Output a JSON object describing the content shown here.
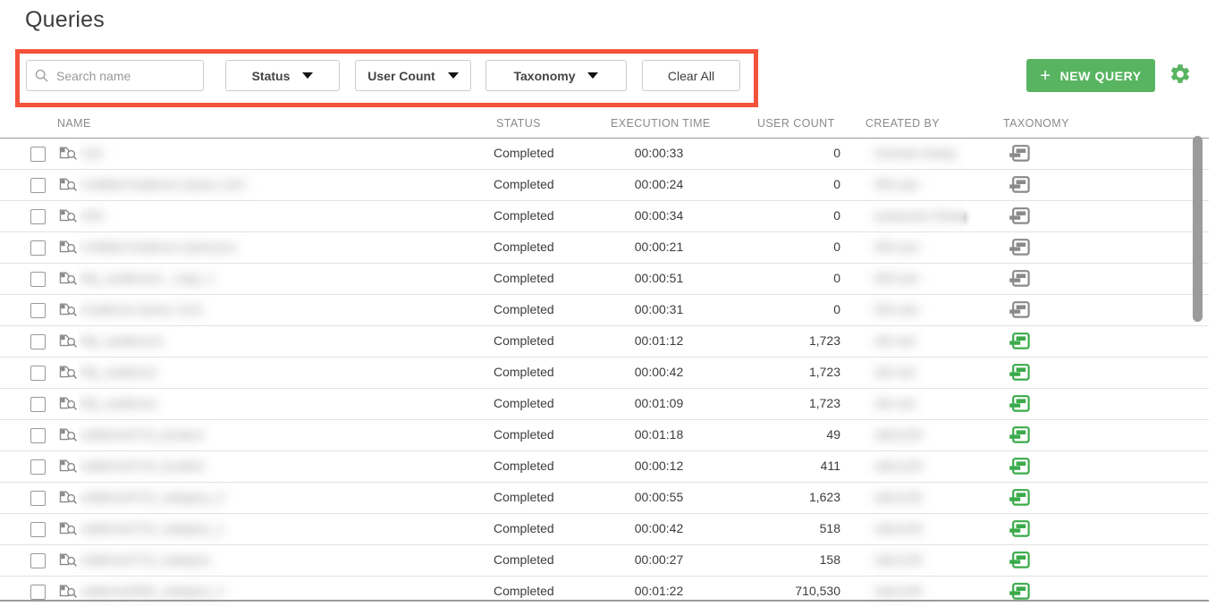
{
  "header": {
    "title": "Queries"
  },
  "toolbar": {
    "search": {
      "placeholder": "Search name",
      "value": "",
      "icon": "search-icon"
    },
    "filters": [
      {
        "id": "status",
        "label": "Status",
        "icon": "chevron-down-icon"
      },
      {
        "id": "usercount",
        "label": "User Count",
        "icon": "chevron-down-icon"
      },
      {
        "id": "taxonomy",
        "label": "Taxonomy",
        "icon": "chevron-down-icon"
      }
    ],
    "clear_all_label": "Clear All",
    "new_query_label": "NEW QUERY",
    "new_query_icon": "plus-icon",
    "settings_icon": "gear-icon",
    "highlight_color": "#f4523b",
    "accent_color": "#58b461"
  },
  "table": {
    "columns": [
      "NAME",
      "STATUS",
      "EXECUTION TIME",
      "USER COUNT",
      "CREATED BY",
      "TAXONOMY"
    ],
    "row_icon": "document-search-icon",
    "checkbox_icon": "checkbox-unchecked-icon",
    "taxonomy_icon": "taxonomy-layout-icon",
    "taxonomy_colors": {
      "inactive": "#8a8a8a",
      "active": "#3aaa4a"
    },
    "rows": [
      {
        "name": "110",
        "status": "Completed",
        "exec": "00:00:33",
        "users": "0",
        "created_by": "michael zhang",
        "taxonomy_state": "inactive"
      },
      {
        "name": "Untitled Audience Query 1111",
        "status": "Completed",
        "exec": "00:00:24",
        "users": "0",
        "created_by": "000 yan",
        "taxonomy_state": "inactive"
      },
      {
        "name": "444",
        "status": "Completed",
        "exec": "00:00:34",
        "users": "0",
        "created_by": "yuanyuan zhang",
        "taxonomy_state": "inactive"
      },
      {
        "name": "Untitled Audience Queryxxx",
        "status": "Completed",
        "exec": "00:00:21",
        "users": "0",
        "created_by": "000 yan",
        "taxonomy_state": "inactive"
      },
      {
        "name": "My_audience1 _copy_1",
        "status": "Completed",
        "exec": "00:00:51",
        "users": "0",
        "created_by": "000 yan",
        "taxonomy_state": "inactive"
      },
      {
        "name": "Audience Query 1221",
        "status": "Completed",
        "exec": "00:00:31",
        "users": "0",
        "created_by": "000 yan",
        "taxonomy_state": "inactive"
      },
      {
        "name": "My_audience1",
        "status": "Completed",
        "exec": "00:01:12",
        "users": "1,723",
        "created_by": "sile wei",
        "taxonomy_state": "active"
      },
      {
        "name": "My_audience",
        "status": "Completed",
        "exec": "00:00:42",
        "users": "1,723",
        "created_by": "sile wei",
        "taxonomy_state": "active"
      },
      {
        "name": "My_audience",
        "status": "Completed",
        "exec": "00:01:09",
        "users": "1,723",
        "created_by": "sile wei",
        "taxonomy_state": "active"
      },
      {
        "name": "sddemo0715_product",
        "status": "Completed",
        "exec": "00:01:18",
        "users": "49",
        "created_by": "sde1128",
        "taxonomy_state": "active"
      },
      {
        "name": "sddemo0715_location",
        "status": "Completed",
        "exec": "00:00:12",
        "users": "411",
        "created_by": "sde1128",
        "taxonomy_state": "active"
      },
      {
        "name": "sddemo0715_category_3",
        "status": "Completed",
        "exec": "00:00:55",
        "users": "1,623",
        "created_by": "sde1128",
        "taxonomy_state": "active"
      },
      {
        "name": "sddemo0715_category_1",
        "status": "Completed",
        "exec": "00:00:42",
        "users": "518",
        "created_by": "sde1128",
        "taxonomy_state": "active"
      },
      {
        "name": "sddemo0715_category",
        "status": "Completed",
        "exec": "00:00:27",
        "users": "158",
        "created_by": "sde1128",
        "taxonomy_state": "active"
      },
      {
        "name": "sddemo0506_category_2",
        "status": "Completed",
        "exec": "00:01:22",
        "users": "710,530",
        "created_by": "sde1128",
        "taxonomy_state": "active"
      }
    ]
  },
  "scrollbar": {
    "name": "vertical-scrollbar"
  }
}
